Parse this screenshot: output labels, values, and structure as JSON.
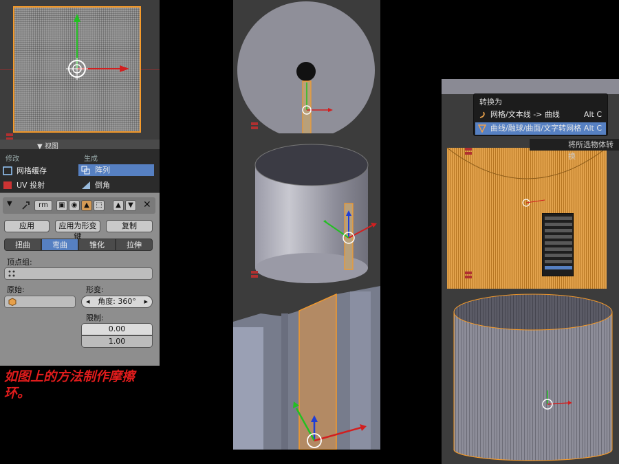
{
  "colors": {
    "selection": "#5680c2",
    "edge_orange": "#f59a2a",
    "caption_red": "#e01c1c",
    "viewport_bg": "#3c3c3c",
    "panel_gray": "#8e8e8e"
  },
  "left_panel": {
    "partial_header": "▼ 视图",
    "modify_header": "修改",
    "generate_header": "生成",
    "mesh_cache_label": "网格缓存",
    "array_label": "阵列",
    "uv_project_label": "UV 投射",
    "bevel_label": "倒角",
    "modifier_name": "rm",
    "apply_label": "应用",
    "apply_as_shapekey_label": "应用为形变键",
    "copy_label": "复制",
    "deform_methods": [
      "扭曲",
      "弯曲",
      "锥化",
      "拉伸"
    ],
    "active_method_index": 1,
    "vertex_group_label": "顶点组:",
    "origin_label": "原始:",
    "deform_label": "形变:",
    "angle_value": "角度: 360°",
    "limits_label": "限制:",
    "limit_min": "0.00",
    "limit_max": "1.00"
  },
  "caption": "如图上的方法制作摩擦环。",
  "right_panel": {
    "convert_menu_title": "转换为",
    "convert_items": [
      {
        "label": "网格/文本线 -> 曲线",
        "shortcut": "Alt C"
      },
      {
        "label": "曲线/融球/曲面/文字转网格",
        "shortcut": "Alt C"
      }
    ],
    "selected_index": 1,
    "tooltip": "将所选物体转换"
  },
  "icons": [
    "modifier-wrench-icon",
    "render-icon",
    "eye-icon",
    "editmode-icon",
    "cage-icon",
    "up-arrow-icon",
    "down-arrow-icon",
    "close-icon",
    "vertex-group-icon",
    "cube-icon",
    "transform-manipulator-icon",
    "red-down-arrow-icon"
  ]
}
